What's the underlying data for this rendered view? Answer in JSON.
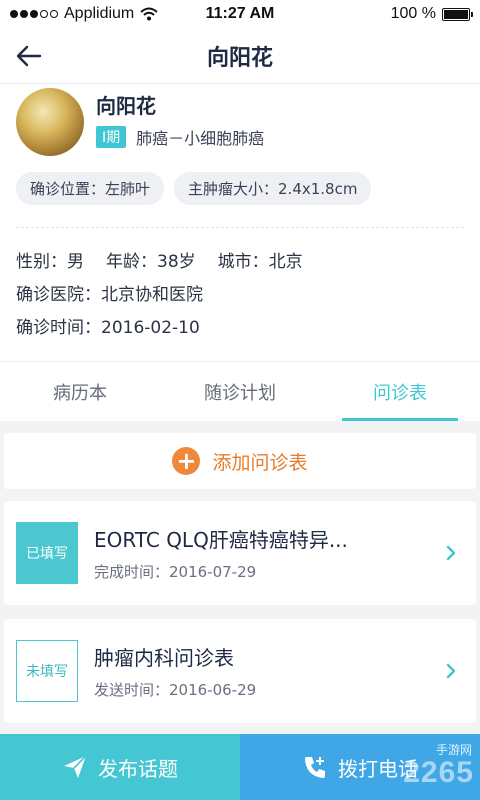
{
  "status_bar": {
    "carrier": "Applidium",
    "time": "11:27 AM",
    "battery_text": "100 %",
    "battery_level": 1.0
  },
  "nav": {
    "title": "向阳花"
  },
  "profile": {
    "name": "向阳花",
    "stage": "I期",
    "diagnosis": "肺癌－小细胞肺癌",
    "chips": {
      "location": "确诊位置：左肺叶",
      "tumor_size": "主肿瘤大小：2.4x1.8cm"
    },
    "details": {
      "gender": "性别：男",
      "age": "年龄：38岁",
      "city": "城市：北京",
      "hospital": "确诊医院：北京协和医院",
      "date": "确诊时间：2016-02-10"
    }
  },
  "tabs": {
    "records": "病历本",
    "followup": "随诊计划",
    "questionnaire": "问诊表"
  },
  "add_button": {
    "label": "添加问诊表"
  },
  "forms": [
    {
      "status": "已填写",
      "title": "EORTC QLQ肝癌特癌特异...",
      "date": "完成时间：2016-07-29"
    },
    {
      "status": "未填写",
      "title": "肿瘤内科问诊表",
      "date": "发送时间：2016-06-29"
    }
  ],
  "bottom": {
    "post_label": "发布话题",
    "call_label": "拨打电话"
  },
  "watermark": {
    "main": "2265",
    "sub": "手游网"
  },
  "colors": {
    "accent": "#3fc6d3",
    "orange": "#f0883b",
    "call": "#3fa7e6",
    "title": "#1f2a44"
  }
}
